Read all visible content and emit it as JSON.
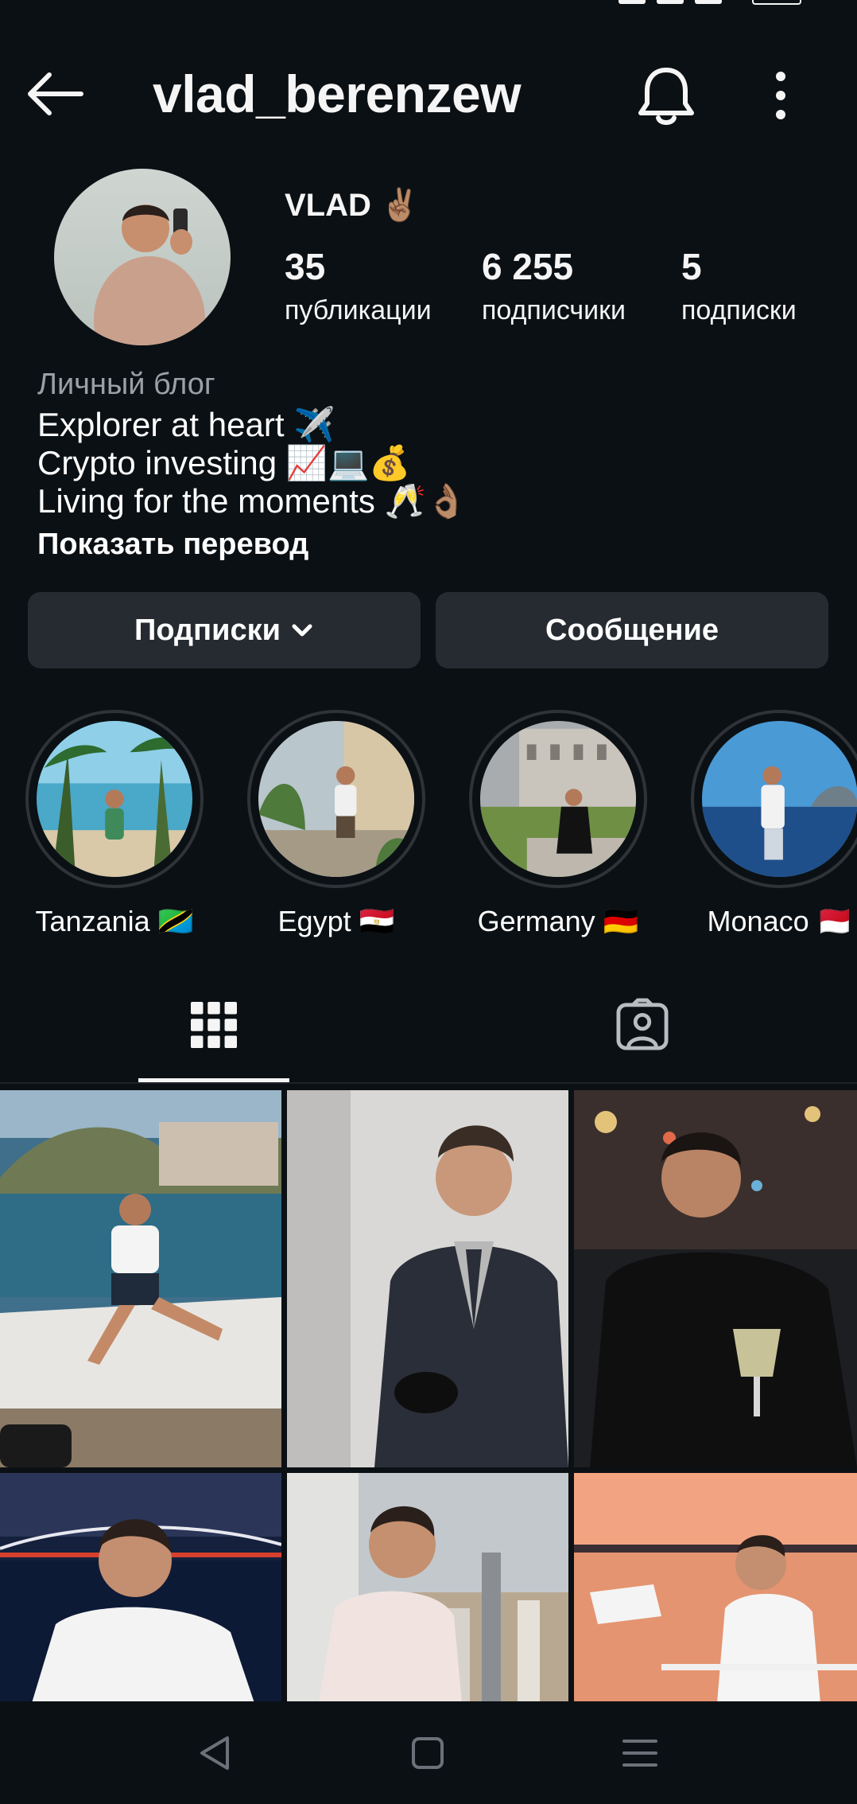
{
  "header": {
    "username": "vlad_berenzew",
    "back_icon": "arrow-left-icon",
    "notify_icon": "bell-icon",
    "more_icon": "more-vertical-icon"
  },
  "profile": {
    "display_name": "VLAD ✌🏽",
    "stats": [
      {
        "value": "35",
        "label": "публикации"
      },
      {
        "value": "6 255",
        "label": "подписчики"
      },
      {
        "value": "5",
        "label": "подписки"
      }
    ],
    "bio": {
      "category": "Личный блог",
      "lines": [
        "Explorer at heart ✈️",
        "Crypto investing 📈💻💰",
        "Living for the moments 🥂👌🏽"
      ],
      "translate_link": "Показать перевод"
    }
  },
  "actions": {
    "following_label": "Подписки",
    "message_label": "Сообщение"
  },
  "highlights": [
    {
      "label": "Tanzania 🇹🇿"
    },
    {
      "label": "Egypt 🇪🇬"
    },
    {
      "label": "Germany 🇩🇪"
    },
    {
      "label": "Monaco 🇲🇨"
    }
  ],
  "tabs": [
    {
      "name": "posts",
      "icon": "grid-icon",
      "active": true
    },
    {
      "name": "tagged",
      "icon": "tagged-person-icon",
      "active": false
    }
  ],
  "navbar": {
    "icons": [
      "nav-back-icon",
      "nav-home-icon",
      "nav-menu-icon"
    ]
  },
  "colors": {
    "background": "#0b1014",
    "button": "#262b31",
    "muted_text": "#9aa0a6"
  }
}
